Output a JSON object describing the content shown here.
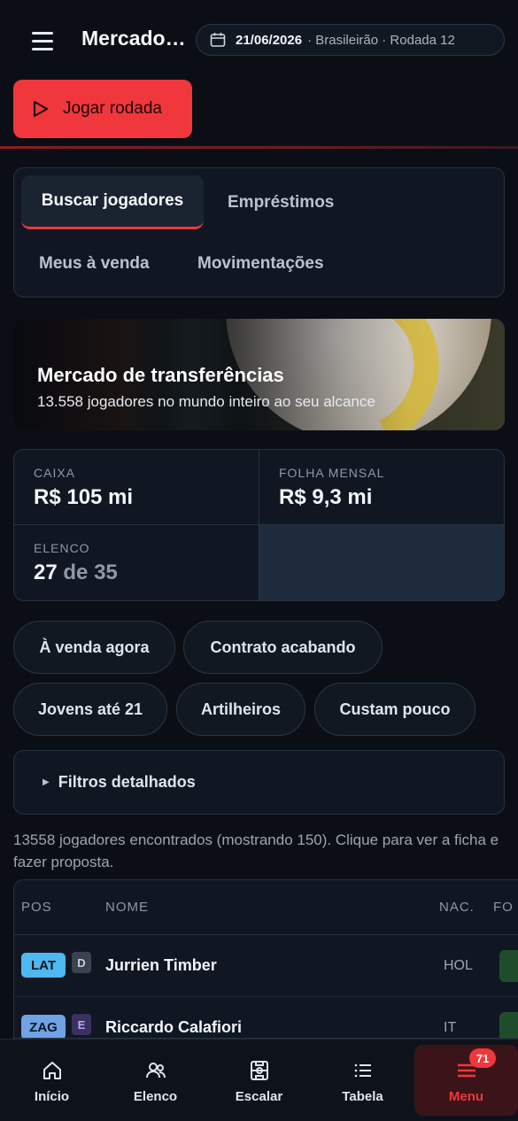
{
  "header": {
    "title": "Mercado de transferências",
    "date": "21/06/2026",
    "context": "· Brasileirão · Rodada 12",
    "play_label": "Jogar rodada"
  },
  "tabs": [
    {
      "label": "Buscar jogadores",
      "active": true
    },
    {
      "label": "Empréstimos"
    },
    {
      "label": "Meus à venda"
    },
    {
      "label": "Movimentações"
    }
  ],
  "banner": {
    "title": "Mercado de transferências",
    "subtitle": "13.558 jogadores no mundo inteiro ao seu alcance"
  },
  "stats": {
    "caixa": {
      "label": "CAIXA",
      "value": "R$ 105 mi"
    },
    "folha": {
      "label": "FOLHA MENSAL",
      "value": "R$ 9,3 mi"
    },
    "elenco": {
      "label": "ELENCO",
      "value": "27",
      "sep": "de",
      "max": "35"
    }
  },
  "chips": [
    "À venda agora",
    "Contrato acabando",
    "Jovens até 21",
    "Artilheiros",
    "Custam pouco"
  ],
  "filters": {
    "label": "Filtros detalhados"
  },
  "results_text": "13558 jogadores encontrados (mostrando 150). Clique para ver a ficha e fazer proposta.",
  "table": {
    "headers": {
      "pos": "POS",
      "name": "NOME",
      "nat": "NAC.",
      "fo": "FO"
    },
    "rows": [
      {
        "pos": "LAT",
        "grade": "D",
        "name": "Jurrien Timber",
        "nat": "HOL",
        "pos_color": "#4fb8f0",
        "grade_bg": "#3a4350",
        "grade_color": "#c9d1db"
      },
      {
        "pos": "ZAG",
        "grade": "E",
        "name": "Riccardo Calafiori",
        "nat": "IT",
        "pos_color": "#6fa3e6",
        "grade_bg": "#3a3160",
        "grade_color": "#b8a6f0"
      }
    ]
  },
  "nav": [
    {
      "label": "Início",
      "icon": "home-icon"
    },
    {
      "label": "Elenco",
      "icon": "users-icon"
    },
    {
      "label": "Escalar",
      "icon": "pitch-icon"
    },
    {
      "label": "Tabela",
      "icon": "list-icon"
    },
    {
      "label": "Menu",
      "icon": "menu-icon",
      "active": true,
      "badge": "71"
    }
  ],
  "colors": {
    "accent": "#f0373b",
    "background": "#0b0f15"
  }
}
